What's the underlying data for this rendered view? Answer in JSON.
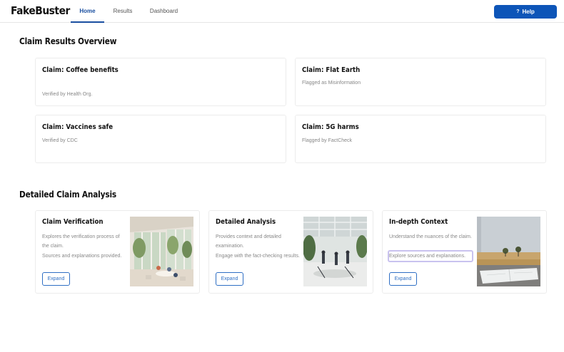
{
  "app": {
    "brand": "FakeBuster"
  },
  "nav": {
    "tabs": [
      {
        "label": "Home",
        "active": true
      },
      {
        "label": "Results",
        "active": false
      },
      {
        "label": "Dashboard",
        "active": false
      }
    ],
    "help_icon": "?",
    "help_label": "Help"
  },
  "overview": {
    "title": "Claim Results Overview",
    "cards": [
      {
        "title": "Claim: Coffee benefits",
        "subtitle": "Verified by Health Org."
      },
      {
        "title": "Claim: Flat Earth",
        "subtitle": "Flagged as Misinformation"
      },
      {
        "title": "Claim: Vaccines safe",
        "subtitle": "Verified by CDC"
      },
      {
        "title": "Claim: 5G harms",
        "subtitle": "Flagged by FactCheck"
      }
    ]
  },
  "analysis": {
    "title": "Detailed Claim Analysis",
    "cards": [
      {
        "title": "Claim Verification",
        "desc1": "Explores the verification process of the claim.",
        "desc2": "Sources and explanations provided.",
        "button": "Expand",
        "image_icon": "office-interior-photo"
      },
      {
        "title": "Detailed Analysis",
        "desc1": "Provides context and detailed examination.",
        "desc2": "Engage with the fact-checking results.",
        "button": "Expand",
        "image_icon": "atrium-meeting-photo"
      },
      {
        "title": "In-depth Context",
        "desc1": "Understand the nuances of the claim.",
        "desc2": "Explore sources and explanations.",
        "button": "Expand",
        "image_icon": "landscape-book-photo"
      }
    ]
  },
  "colors": {
    "accent": "#0d55b8",
    "highlight": "#c9c2ef"
  }
}
